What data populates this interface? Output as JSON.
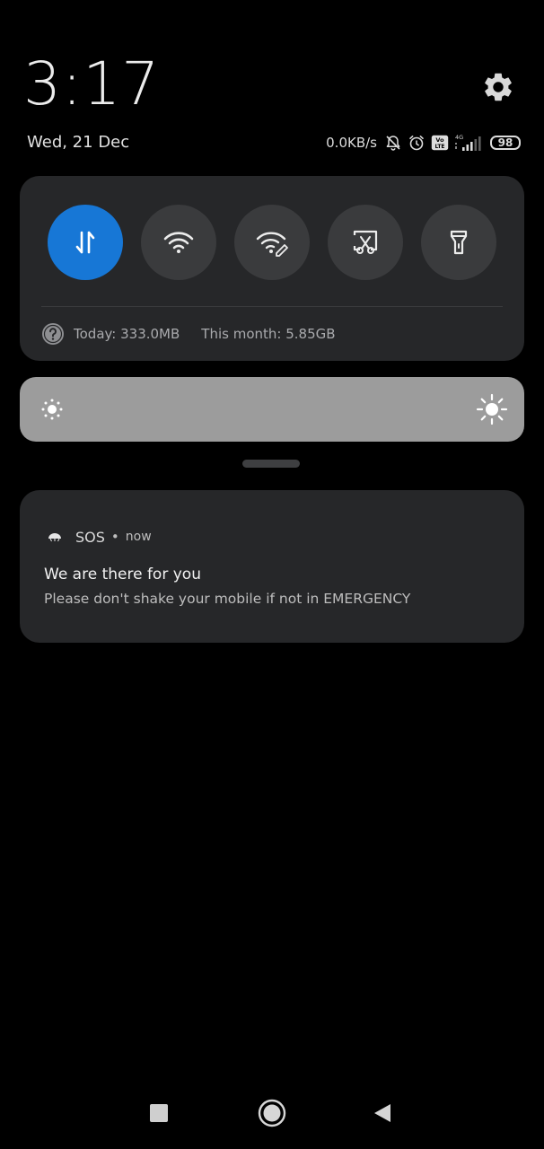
{
  "header": {
    "time": "3:17",
    "date": "Wed, 21 Dec"
  },
  "status_bar": {
    "net_speed": "0.0KB/s",
    "network_type": "4G",
    "volte_badge": "Vo LTE",
    "battery_level": "98",
    "icons": [
      "silent-bell-icon",
      "alarm-icon",
      "volte-icon",
      "signal-icon",
      "battery-icon"
    ]
  },
  "quick_settings": {
    "toggles": [
      {
        "name": "mobile-data",
        "icon": "data-transfer-icon",
        "active": true
      },
      {
        "name": "wifi",
        "icon": "wifi-icon",
        "active": false
      },
      {
        "name": "hotspot",
        "icon": "wifi-edit-icon",
        "active": false
      },
      {
        "name": "screenshot",
        "icon": "scissors-screen-icon",
        "active": false
      },
      {
        "name": "flashlight",
        "icon": "flashlight-icon",
        "active": false
      }
    ],
    "usage_today": "Today: 333.0MB",
    "usage_month": "This month: 5.85GB"
  },
  "brightness": {
    "level_percent": 100
  },
  "notification": {
    "app_name": "SOS",
    "separator": "•",
    "time": "now",
    "title": "We are there for you",
    "body": "Please don't shake your mobile if not in EMERGENCY"
  },
  "colors": {
    "background": "#000000",
    "card": "#262729",
    "toggle_inactive": "#3a3b3d",
    "toggle_active": "#1777d6",
    "slider": "#9c9c9c"
  }
}
